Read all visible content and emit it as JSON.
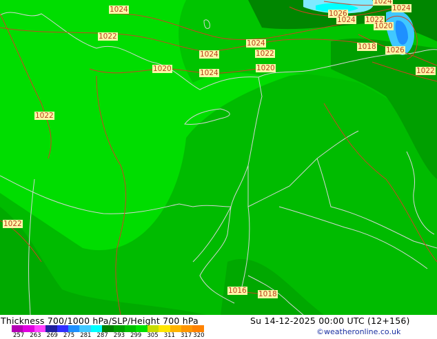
{
  "footer": {
    "title": "Thickness 700/1000 hPa/SLP/Height 700 hPa",
    "datetime": "Su 14-12-2025 00:00 UTC (12+156)",
    "credit": "©weatheronline.co.uk"
  },
  "colorbar": {
    "ticks": [
      "257",
      "263",
      "269",
      "275",
      "281",
      "287",
      "293",
      "299",
      "305",
      "311",
      "317",
      "320"
    ],
    "colors": [
      "#b400b4",
      "#e000e0",
      "#ff40ff",
      "#2020a0",
      "#3030ff",
      "#1e90ff",
      "#40c8ff",
      "#00ffff",
      "#008000",
      "#00a000",
      "#00c000",
      "#00e000",
      "#c8dc00",
      "#ffe600",
      "#ffb400",
      "#ff9600",
      "#ff8200"
    ]
  },
  "isobar_labels": [
    {
      "text": "1024"
    },
    {
      "text": "1022"
    },
    {
      "text": "1024"
    },
    {
      "text": "1024"
    },
    {
      "text": "1022"
    },
    {
      "text": "1020"
    },
    {
      "text": "1024"
    },
    {
      "text": "1020"
    },
    {
      "text": "1022"
    },
    {
      "text": "1026"
    },
    {
      "text": "1024"
    },
    {
      "text": "1022"
    },
    {
      "text": "1024"
    },
    {
      "text": "1024"
    },
    {
      "text": "1020"
    },
    {
      "text": "1018"
    },
    {
      "text": "1026"
    },
    {
      "text": "1022"
    },
    {
      "text": "1022"
    },
    {
      "text": "1016"
    },
    {
      "text": "1018"
    }
  ],
  "colors": {
    "bright_green": "#00dd00",
    "mid_green": "#00bb00",
    "dark_green": "#009a00",
    "darkest_green": "#007800",
    "cyan": "#00e0e0",
    "light_cyan": "#7feaff",
    "isobar": "#cc4422",
    "border": "#cfcfcf"
  }
}
